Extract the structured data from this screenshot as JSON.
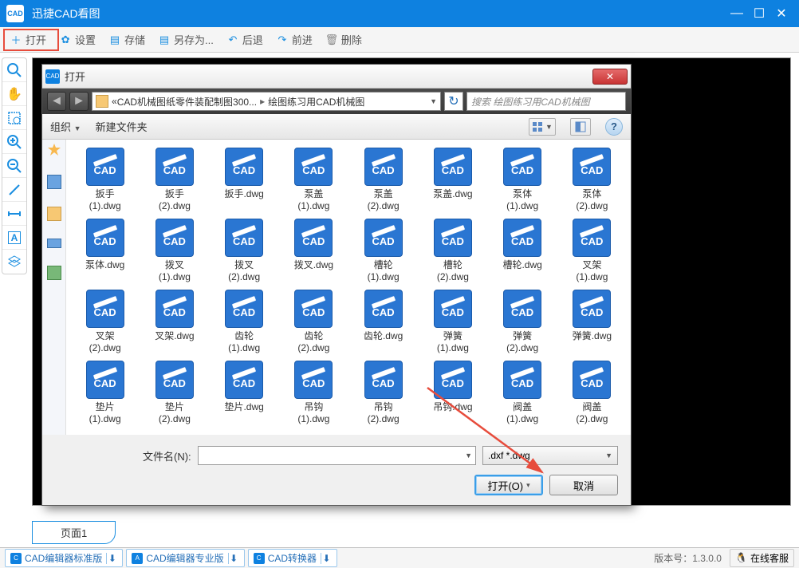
{
  "app": {
    "title": "迅捷CAD看图",
    "icon_label": "CAD"
  },
  "toolbar": {
    "open": "打开",
    "settings": "设置",
    "save": "存储",
    "saveas": "另存为...",
    "back": "后退",
    "forward": "前进",
    "delete": "删除"
  },
  "tabs": {
    "page1": "页面1"
  },
  "statusbar": {
    "editor_std": "CAD编辑器标准版",
    "editor_pro": "CAD编辑器专业版",
    "converter": "CAD转换器",
    "version": "版本号：1.3.0.0",
    "kefu": "在线客服"
  },
  "dialog": {
    "title": "打开",
    "breadcrumb": {
      "prefix": "«",
      "seg1": "CAD机械图纸零件装配制图300...",
      "seg2": "绘图练习用CAD机械图"
    },
    "search_placeholder": "搜索 绘图练习用CAD机械图",
    "toolbar": {
      "organize": "组织",
      "newfolder": "新建文件夹"
    },
    "footer": {
      "filename_label": "文件名(N):",
      "filetype": ".dxf *.dwg",
      "open_btn": "打开(O)",
      "cancel_btn": "取消"
    },
    "files": [
      {
        "name": "扳手(1).dwg"
      },
      {
        "name": "扳手(2).dwg"
      },
      {
        "name": "扳手.dwg"
      },
      {
        "name": "泵盖(1).dwg"
      },
      {
        "name": "泵盖(2).dwg"
      },
      {
        "name": "泵盖.dwg"
      },
      {
        "name": "泵体(1).dwg"
      },
      {
        "name": "泵体(2).dwg"
      },
      {
        "name": "泵体.dwg"
      },
      {
        "name": "拨叉(1).dwg"
      },
      {
        "name": "拨叉(2).dwg"
      },
      {
        "name": "拨叉.dwg"
      },
      {
        "name": "槽轮(1).dwg"
      },
      {
        "name": "槽轮(2).dwg"
      },
      {
        "name": "槽轮.dwg"
      },
      {
        "name": "叉架(1).dwg"
      },
      {
        "name": "叉架(2).dwg"
      },
      {
        "name": "叉架.dwg"
      },
      {
        "name": "齿轮(1).dwg"
      },
      {
        "name": "齿轮(2).dwg"
      },
      {
        "name": "齿轮.dwg"
      },
      {
        "name": "弹簧(1).dwg"
      },
      {
        "name": "弹簧(2).dwg"
      },
      {
        "name": "弹簧.dwg"
      },
      {
        "name": "垫片(1).dwg"
      },
      {
        "name": "垫片(2).dwg"
      },
      {
        "name": "垫片.dwg"
      },
      {
        "name": "吊钩(1).dwg"
      },
      {
        "name": "吊钩(2).dwg"
      },
      {
        "name": "吊钩.dwg"
      },
      {
        "name": "阀盖(1).dwg"
      },
      {
        "name": "阀盖(2).dwg"
      }
    ]
  }
}
